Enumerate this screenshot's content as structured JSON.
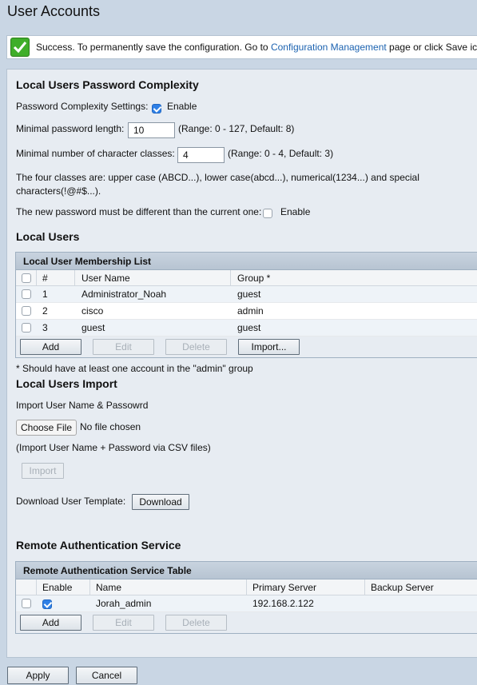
{
  "page": {
    "title": "User Accounts"
  },
  "success": {
    "text_before": "Success. To permanently save the configuration. Go to ",
    "link": "Configuration Management",
    "text_after": " page or click Save icon."
  },
  "complexity": {
    "title": "Local Users Password Complexity",
    "settings_label": "Password Complexity Settings:",
    "settings_enable_label": "Enable",
    "settings_enabled": true,
    "min_length_label": "Minimal password length:",
    "min_length_value": "10",
    "min_length_hint": "(Range: 0 - 127, Default: 8)",
    "min_classes_label": "Minimal number of character classes:",
    "min_classes_value": "4",
    "min_classes_hint": "(Range: 0 - 4, Default: 3)",
    "classes_note_line1": "The four classes are: upper case (ABCD...), lower case(abcd...), numerical(1234...) and special",
    "classes_note_line2": "characters(!@#$...).",
    "different_label": "The new password must be different than the current one:",
    "different_enable_label": "Enable",
    "different_enabled": false
  },
  "local_users": {
    "title": "Local Users",
    "table_caption": "Local User Membership List",
    "columns": {
      "num": "#",
      "user_name": "User Name",
      "group": "Group *"
    },
    "rows": [
      {
        "num": "1",
        "user_name": "Administrator_Noah",
        "group": "guest"
      },
      {
        "num": "2",
        "user_name": "cisco",
        "group": "admin"
      },
      {
        "num": "3",
        "user_name": "guest",
        "group": "guest"
      }
    ],
    "buttons": {
      "add": "Add",
      "edit": "Edit",
      "delete": "Delete",
      "import": "Import..."
    },
    "note": "* Should have at least one account in the \"admin\" group"
  },
  "import": {
    "title": "Local Users Import",
    "label": "Import User Name & Passowrd",
    "choose_file": "Choose File",
    "no_file": "No file chosen",
    "hint": "(Import User Name + Password via CSV files)",
    "import_button": "Import",
    "download_label": "Download User Template:",
    "download_button": "Download"
  },
  "remote": {
    "title": "Remote Authentication Service",
    "table_caption": "Remote Authentication Service Table",
    "columns": {
      "enable": "Enable",
      "name": "Name",
      "primary": "Primary Server",
      "backup": "Backup Server"
    },
    "rows": [
      {
        "enabled": true,
        "name": "Jorah_admin",
        "primary": "192.168.2.122",
        "backup": ""
      }
    ],
    "buttons": {
      "add": "Add",
      "edit": "Edit",
      "delete": "Delete"
    }
  },
  "footer": {
    "apply": "Apply",
    "cancel": "Cancel"
  },
  "colors": {
    "background": "#c9d6e4",
    "panel": "#e7ecf2",
    "link": "#1b62b0",
    "checkbox_checked": "#2f80e6",
    "success_icon": "#3fae2a"
  }
}
